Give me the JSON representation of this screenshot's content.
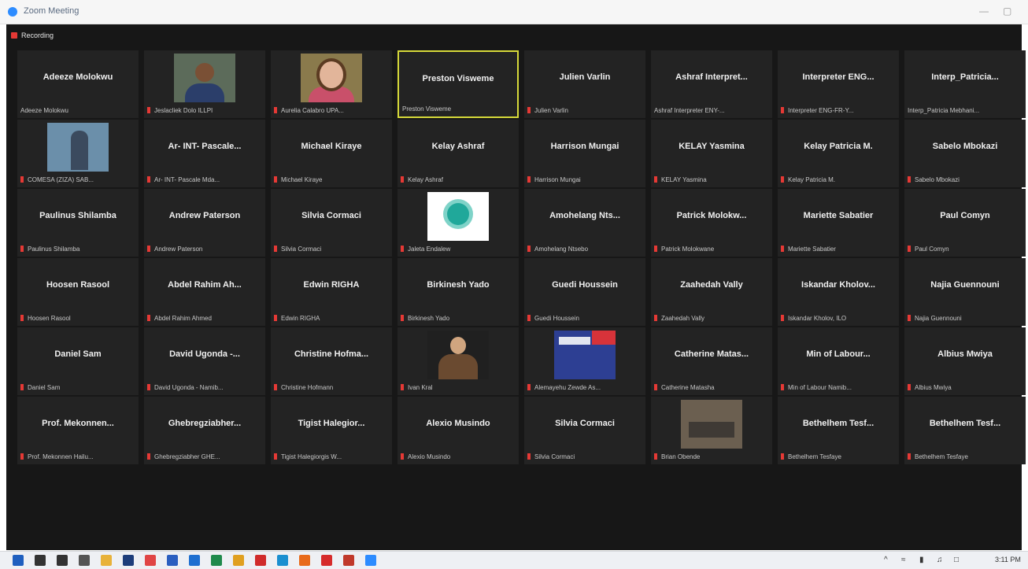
{
  "window": {
    "title": "Zoom Meeting",
    "controls": [
      "minimize-icon",
      "maximize-icon"
    ]
  },
  "recording": {
    "label": "Recording"
  },
  "participants": [
    {
      "name": "Adeeze Molokwu",
      "label": "Adeeze Molokwu",
      "muted": false,
      "avatar": "none"
    },
    {
      "name": "",
      "label": "Jeslacliek Dolo ILLPI",
      "muted": true,
      "avatar": "person"
    },
    {
      "name": "",
      "label": "Aurelia Calabro UPA...",
      "muted": true,
      "avatar": "woman"
    },
    {
      "name": "Preston Visweme",
      "label": "Preston Visweme",
      "muted": false,
      "avatar": "none",
      "active": true
    },
    {
      "name": "Julien Varlin",
      "label": "Julien Varlin",
      "muted": true,
      "avatar": "none"
    },
    {
      "name": "Ashraf Interpret...",
      "label": "Ashraf Interpreter ENY-...",
      "muted": false,
      "avatar": "none"
    },
    {
      "name": "Interpreter ENG...",
      "label": "Interpreter ENG-FR-Y...",
      "muted": true,
      "avatar": "none"
    },
    {
      "name": "Interp_Patricia...",
      "label": "Interp_Patricia Mebhani...",
      "muted": false,
      "avatar": "none"
    },
    {
      "name": "",
      "label": "COMESA (ZIZA) SAB...",
      "muted": true,
      "avatar": "office"
    },
    {
      "name": "Ar- INT- Pascale...",
      "label": "Ar- INT- Pascale Mda...",
      "muted": true,
      "avatar": "none"
    },
    {
      "name": "Michael Kiraye",
      "label": "Michael Kiraye",
      "muted": true,
      "avatar": "none"
    },
    {
      "name": "Kelay Ashraf",
      "label": "Kelay Ashraf",
      "muted": true,
      "avatar": "none"
    },
    {
      "name": "Harrison Mungai",
      "label": "Harrison Mungai",
      "muted": true,
      "avatar": "none"
    },
    {
      "name": "KELAY Yasmina",
      "label": "KELAY Yasmina",
      "muted": true,
      "avatar": "none"
    },
    {
      "name": "Kelay Patricia M.",
      "label": "Kelay Patricia M.",
      "muted": true,
      "avatar": "none"
    },
    {
      "name": "Sabelo Mbokazi",
      "label": "Sabelo Mbokazi",
      "muted": true,
      "avatar": "none"
    },
    {
      "name": "Paulinus Shilamba",
      "label": "Paulinus Shilamba",
      "muted": true,
      "avatar": "none"
    },
    {
      "name": "Andrew Paterson",
      "label": "Andrew Paterson",
      "muted": true,
      "avatar": "none"
    },
    {
      "name": "Silvia Cormaci",
      "label": "Silvia Cormaci",
      "muted": true,
      "avatar": "none"
    },
    {
      "name": "",
      "label": "Jaleta Endalew",
      "muted": true,
      "avatar": "logo"
    },
    {
      "name": "Amohelang Nts...",
      "label": "Amohelang Ntsebo",
      "muted": true,
      "avatar": "none"
    },
    {
      "name": "Patrick Molokw...",
      "label": "Patrick Molokwane",
      "muted": true,
      "avatar": "none"
    },
    {
      "name": "Mariette Sabatier",
      "label": "Mariette Sabatier",
      "muted": true,
      "avatar": "none"
    },
    {
      "name": "Paul Comyn",
      "label": "Paul Comyn",
      "muted": true,
      "avatar": "none"
    },
    {
      "name": "Hoosen Rasool",
      "label": "Hoosen Rasool",
      "muted": true,
      "avatar": "none"
    },
    {
      "name": "Abdel Rahim Ah...",
      "label": "Abdel Rahim Ahmed",
      "muted": true,
      "avatar": "none"
    },
    {
      "name": "Edwin RIGHA",
      "label": "Edwin RIGHA",
      "muted": true,
      "avatar": "none"
    },
    {
      "name": "Birkinesh Yado",
      "label": "Birkinesh Yado",
      "muted": true,
      "avatar": "none"
    },
    {
      "name": "Guedi Houssein",
      "label": "Guedi Houssein",
      "muted": true,
      "avatar": "none"
    },
    {
      "name": "Zaahedah Vally",
      "label": "Zaahedah Vally",
      "muted": true,
      "avatar": "none"
    },
    {
      "name": "Iskandar Kholov...",
      "label": "Iskandar Kholov, ILO",
      "muted": true,
      "avatar": "none"
    },
    {
      "name": "Najia Guennouni",
      "label": "Najia Guennouni",
      "muted": true,
      "avatar": "none"
    },
    {
      "name": "Daniel Sam",
      "label": "Daniel Sam",
      "muted": true,
      "avatar": "none"
    },
    {
      "name": "David Ugonda -...",
      "label": "David Ugonda - Namib...",
      "muted": true,
      "avatar": "none"
    },
    {
      "name": "Christine Hofma...",
      "label": "Christine Hofmann",
      "muted": true,
      "avatar": "none"
    },
    {
      "name": "",
      "label": "Ivan Kral",
      "muted": true,
      "avatar": "man2"
    },
    {
      "name": "",
      "label": "Alemayehu Zewde As...",
      "muted": true,
      "avatar": "banner"
    },
    {
      "name": "Catherine Matas...",
      "label": "Catherine Matasha",
      "muted": true,
      "avatar": "none"
    },
    {
      "name": "Min of Labour...",
      "label": "Min of Labour Namib...",
      "muted": true,
      "avatar": "none"
    },
    {
      "name": "Albius Mwiya",
      "label": "Albius Mwiya",
      "muted": true,
      "avatar": "none"
    },
    {
      "name": "Prof. Mekonnen...",
      "label": "Prof. Mekonnen Hailu...",
      "muted": true,
      "avatar": "none"
    },
    {
      "name": "Ghebregziabher...",
      "label": "Ghebregziabher GHE...",
      "muted": true,
      "avatar": "none"
    },
    {
      "name": "Tigist Halegior...",
      "label": "Tigist Halegiorgis W...",
      "muted": true,
      "avatar": "none"
    },
    {
      "name": "Alexio Musindo",
      "label": "Alexio Musindo",
      "muted": true,
      "avatar": "none"
    },
    {
      "name": "Silvia Cormaci",
      "label": "Silvia Cormaci",
      "muted": true,
      "avatar": "none"
    },
    {
      "name": "",
      "label": "Brian Obende",
      "muted": true,
      "avatar": "room"
    },
    {
      "name": "Bethelhem Tesf...",
      "label": "Bethelhem Tesfaye",
      "muted": true,
      "avatar": "none"
    },
    {
      "name": "Bethelhem Tesf...",
      "label": "Bethelhem Tesfaye",
      "muted": true,
      "avatar": "none"
    }
  ],
  "taskbar": {
    "apps": [
      {
        "icon": "windows-icon",
        "color": "#1f5fbf"
      },
      {
        "icon": "search-icon",
        "color": "#333333"
      },
      {
        "icon": "task-view-icon",
        "color": "#333333"
      },
      {
        "icon": "task-manager-icon",
        "color": "#555555"
      },
      {
        "icon": "file-explorer-icon",
        "color": "#e8b23a"
      },
      {
        "icon": "app-icon",
        "color": "#1d3d7a"
      },
      {
        "icon": "app-icon",
        "color": "#e04545"
      },
      {
        "icon": "app-icon",
        "color": "#2b5fc0"
      },
      {
        "icon": "outlook-icon",
        "color": "#1f6fd0"
      },
      {
        "icon": "excel-icon",
        "color": "#1f8a4c"
      },
      {
        "icon": "chrome-icon",
        "color": "#e0a020"
      },
      {
        "icon": "app-icon",
        "color": "#d02b2b"
      },
      {
        "icon": "app-icon",
        "color": "#1a8fd0"
      },
      {
        "icon": "app-icon",
        "color": "#e86a1a"
      },
      {
        "icon": "acrobat-icon",
        "color": "#d62b2b"
      },
      {
        "icon": "app-icon",
        "color": "#c0392b"
      },
      {
        "icon": "zoom-icon",
        "color": "#2d8cff"
      }
    ],
    "time": "3:11 PM"
  }
}
